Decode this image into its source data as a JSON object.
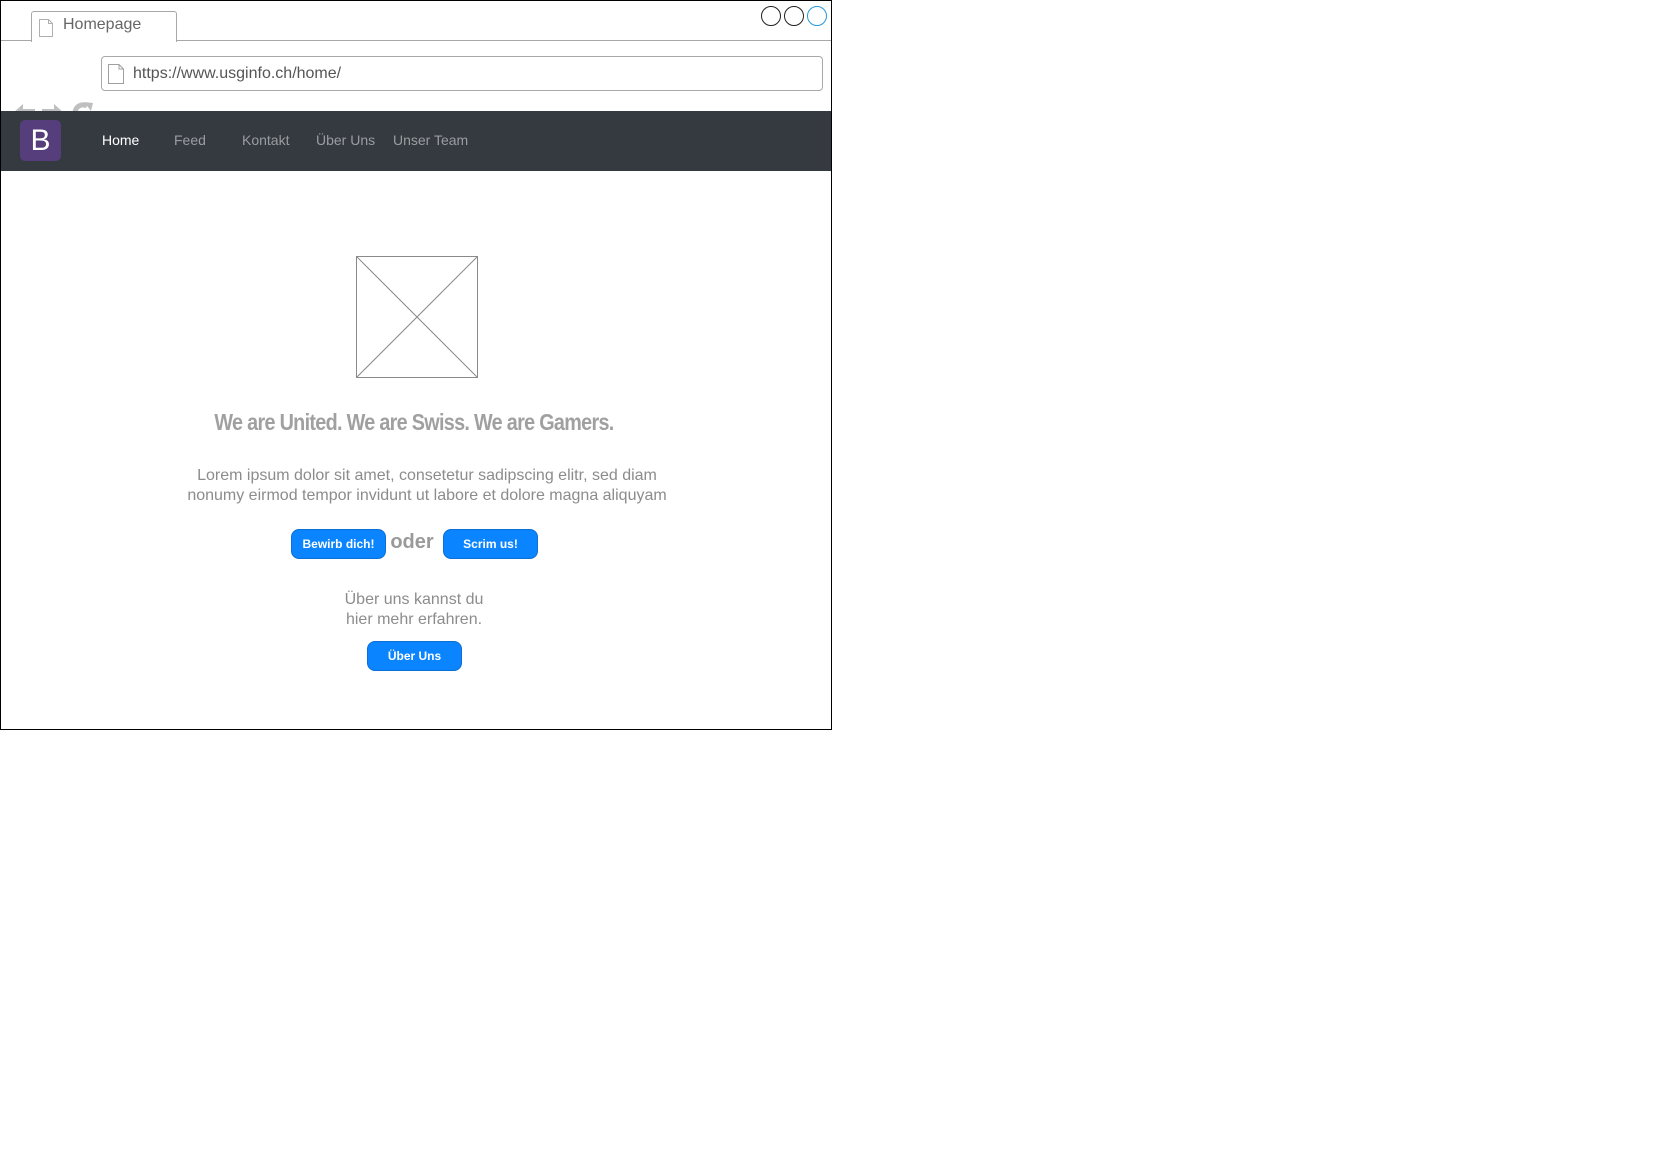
{
  "browser": {
    "tab_title": "Homepage",
    "url": "https://www.usginfo.ch/home/"
  },
  "navbar": {
    "brand_letter": "B",
    "items": [
      {
        "label": "Home",
        "active": true
      },
      {
        "label": "Feed",
        "active": false
      },
      {
        "label": "Kontakt",
        "active": false
      },
      {
        "label": "Über Uns",
        "active": false
      },
      {
        "label": "Unser Team",
        "active": false
      }
    ]
  },
  "hero": {
    "headline": "We are United. We are Swiss. We are Gamers.",
    "lead_line1": "Lorem ipsum dolor sit amet, consetetur sadipscing elitr, sed diam",
    "lead_line2": "nonumy eirmod tempor invidunt ut labore et dolore magna aliquyam",
    "apply_button": "Bewirb dich!",
    "or_text": "oder",
    "scrim_button": "Scrim us!",
    "about_line1": "Über uns kannst du",
    "about_line2": "hier mehr erfahren.",
    "about_button": "Über Uns"
  },
  "colors": {
    "navbar_bg": "#343a40",
    "brand_bg": "#563d7c",
    "button_bg": "#0a84ff",
    "text_muted": "#8c8c8c"
  },
  "icons": [
    "page-icon",
    "back-arrow-icon",
    "forward-arrow-icon",
    "reload-icon",
    "image-placeholder-icon"
  ]
}
